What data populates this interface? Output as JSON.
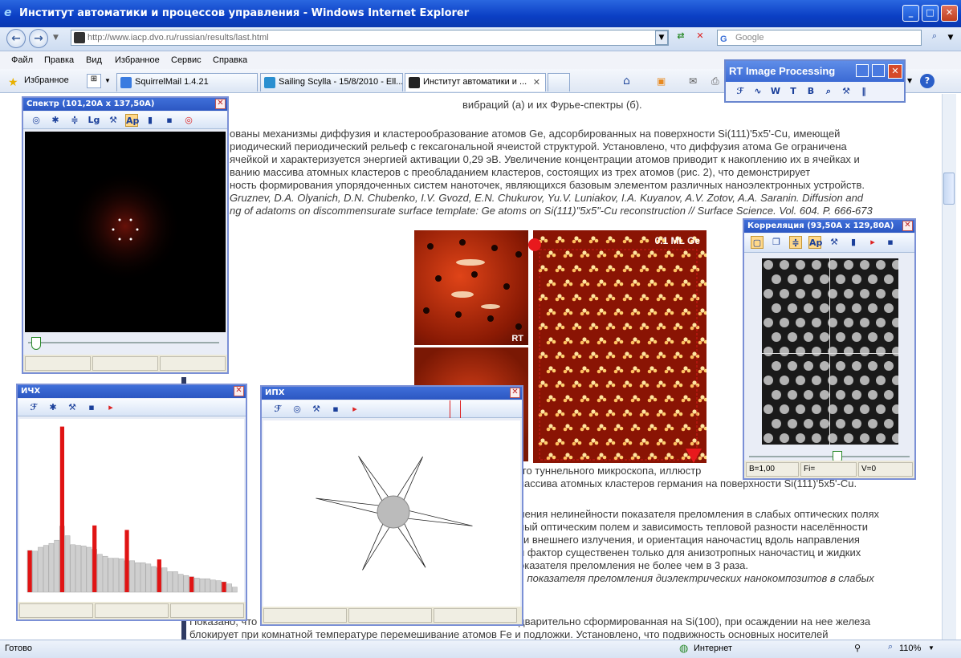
{
  "browser": {
    "title": "Институт автоматики и процессов управления - Windows Internet Explorer",
    "address": "http://www.iacp.dvo.ru/russian/results/last.html",
    "search_placeholder": "Google",
    "menu": [
      "Файл",
      "Правка",
      "Вид",
      "Избранное",
      "Сервис",
      "Справка"
    ],
    "favorites_label": "Избранное",
    "tabs": [
      "SquirrelMail 1.4.21",
      "Sailing Scylla - 15/8/2010 - Ell...",
      "Институт автоматики и ..."
    ],
    "status_left": "Готово",
    "status_zone": "Интернет",
    "zoom": "110%"
  },
  "page": {
    "caption_top": "вибраций (а) и их Фурье-спектры (б).",
    "p1": [
      "ованы механизмы диффузия и кластерообразование атомов Ge, адсорбированных на поверхности Si(111)'5x5'-Cu, имеющей",
      "риодический периодический рельеф с гексагональной ячеистой структурой. Установлено, что диффузия атома Ge ограничена",
      "ячейкой и характеризуется энергией активации 0,29 эВ. Увеличение концентрации атомов приводит к накоплению их в ячейках и",
      "ванию массива атомных кластеров с преобладанием кластеров, состоящих из трех атомов (рис. 2), что демонстрирует",
      "ность формирования упорядоченных систем наноточек, являющихся базовым элементом различных наноэлектронных устройств."
    ],
    "ref": [
      "Gruznev, D.A. Olyanich, D.N. Chubenko, I.V. Gvozd, E.N. Chukurov, Yu.V. Luniakov, I.A. Kuyanov, A.V. Zotov, A.A. Saranin. Diffusion and",
      "ng of adatoms on discommensurate surface template: Ge atoms on Si(111)\"5x5\"-Cu reconstruction // Surface Science. Vol. 604. P. 666-673"
    ],
    "fig_caption": [
      "ощего туннельного микроскопа, иллюстр",
      "ие массива атомных кластеров германия на поверхности Si(111)'5x5'-Cu."
    ],
    "fig_label_rt": "RT",
    "fig_label_ml": "0.1 ML Ge",
    "p2": [
      "ления нелинейности показателя преломления в слабых оптических полях",
      "ный оптическим полем и зависимость тепловой разности населённости",
      "ти внешнего излучения, и ориентация наночастиц вдоль направления",
      "й фактор существенен только для анизотропных наночастиц и жидких",
      "оказателя преломления не более чем в 3 раза."
    ],
    "p2_ref": "ь показателя преломления диэлектрических нанокомпозитов в слабых",
    "p3": [
      "дварительно сформированная на Si(100), при осаждении на нее железа",
      "блокирует при комнатной температуре перемешивание атомов Fe и подложки. Установлено, что подвижность основных носителей"
    ],
    "p3_start": "Показано, что"
  },
  "rt_window": {
    "title": "RT Image Processing"
  },
  "spectrum_window": {
    "title": "Спектр (101,20А x 137,50А)"
  },
  "correlation_window": {
    "title": "Корреляция (93,50А x 129,80А)",
    "status": [
      "B=1,00",
      "Fi=",
      "V=0"
    ]
  },
  "ichx_window": {
    "title": "ИЧХ",
    "histogram": [
      6.5,
      6.4,
      7.0,
      7.3,
      7.6,
      8.1,
      10.3,
      8.8,
      7.4,
      7.3,
      7.2,
      7.0,
      6.7,
      5.9,
      5.6,
      5.3,
      5.3,
      5.2,
      4.9,
      4.9,
      4.6,
      4.6,
      4.4,
      4.0,
      3.8,
      3.8,
      3.2,
      3.2,
      2.8,
      2.6,
      2.4,
      2.2,
      2.1,
      2.1,
      1.9,
      1.8,
      1.6,
      1.3,
      0.8
    ],
    "highlights": [
      0.8,
      0.0,
      0.0,
      0.0,
      0.0,
      0.0,
      25.8,
      0.0,
      0.0,
      0.0,
      0.0,
      0.0,
      10.4,
      0.0,
      0.0,
      0.0,
      0.0,
      0.0,
      9.7,
      0.0,
      0.0,
      0.0,
      0.0,
      0.0,
      5.1,
      0.0,
      0.0,
      0.0,
      0.0,
      0.0,
      0.9,
      0.0,
      0.0,
      0.0,
      0.0,
      0.0,
      0.4,
      0.0,
      0.0
    ]
  },
  "ipx_window": {
    "title": "ИПХ"
  }
}
